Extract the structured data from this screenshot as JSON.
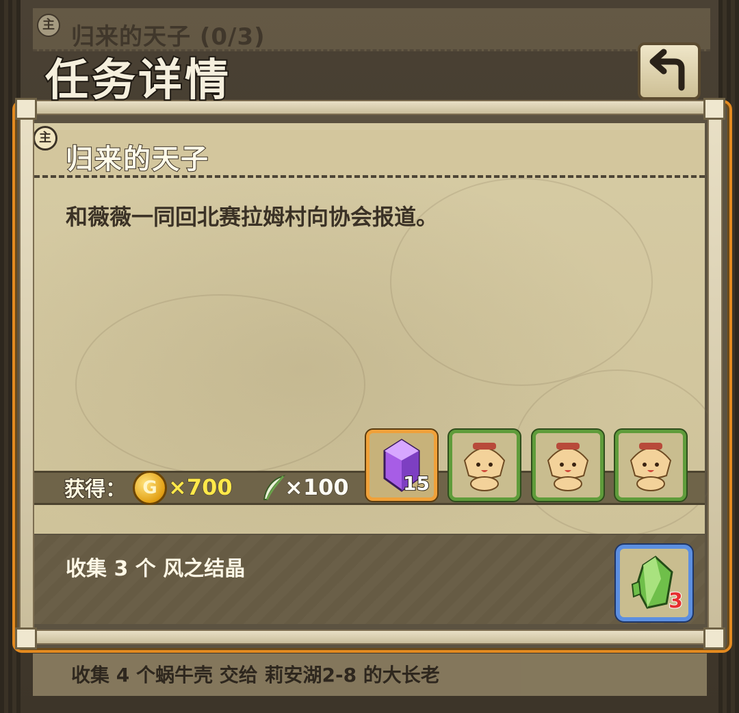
{
  "background_quest": {
    "badge": "主",
    "title": "归来的天子 (0/3)"
  },
  "window": {
    "title": "任务详情",
    "back_icon": "return-arrow-icon"
  },
  "quest": {
    "badge": "主",
    "name": "归来的天子",
    "description": "和薇薇一同回北赛拉姆村向协会报道。"
  },
  "rewards": {
    "label": "获得：",
    "coin": {
      "icon": "gold-coin-icon",
      "symbol": "G",
      "amount": "×700"
    },
    "feather": {
      "icon": "feather-icon",
      "amount": "×100"
    },
    "items": [
      {
        "icon": "purple-crystal-icon",
        "qty": "15",
        "frame_color": "#f0a13a"
      },
      {
        "icon": "mushroom-character-icon",
        "qty": "",
        "frame_color": "#5f9c3b"
      },
      {
        "icon": "mushroom-character-icon",
        "qty": "",
        "frame_color": "#5f9c3b"
      },
      {
        "icon": "mushroom-character-icon",
        "qty": "",
        "frame_color": "#5f9c3b"
      }
    ]
  },
  "objective": {
    "text": "收集 3 个 风之结晶",
    "item": {
      "icon": "green-crystal-icon",
      "qty": "3",
      "frame_color": "#5c8fe0"
    }
  },
  "next_quest": {
    "text": "收集 4 个蜗牛壳 交给 莉安湖2-8 的大长老"
  }
}
